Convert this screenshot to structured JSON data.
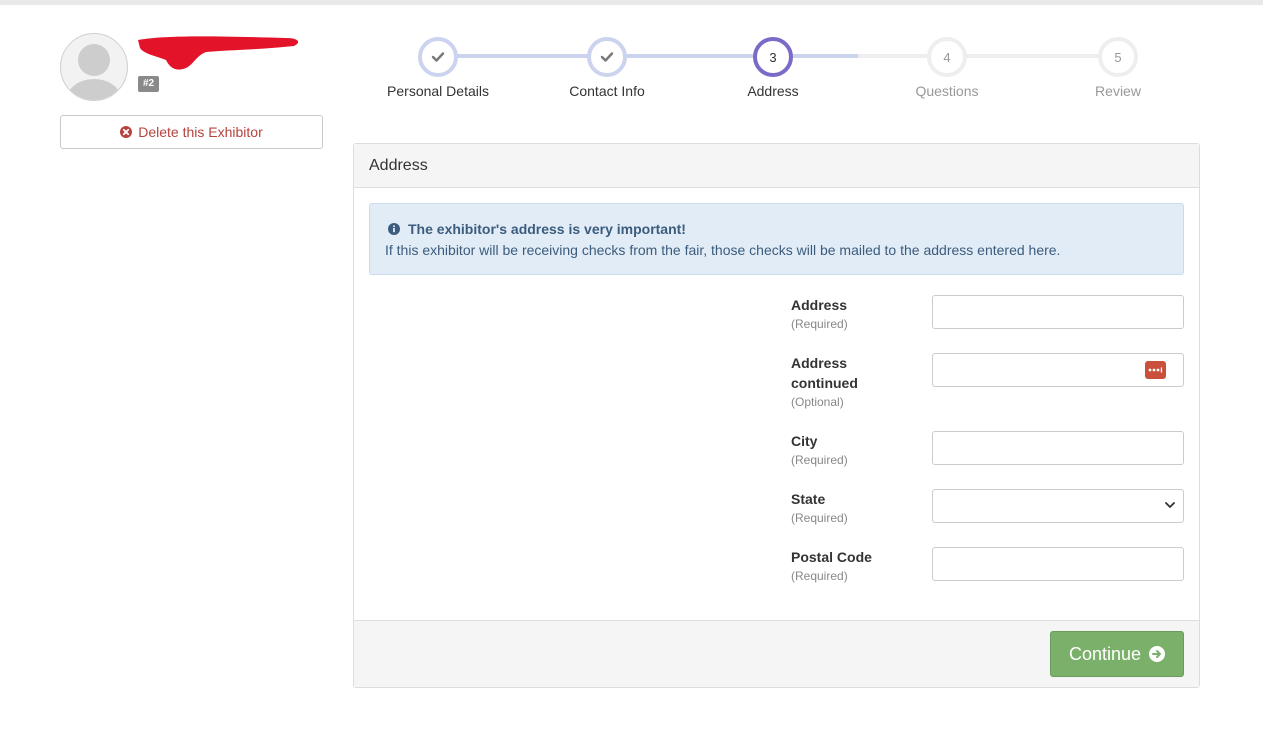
{
  "profile": {
    "id_badge": "#2",
    "delete_label": "Delete this Exhibitor"
  },
  "steps": [
    {
      "number": "1",
      "label": "Personal Details",
      "state": "done"
    },
    {
      "number": "2",
      "label": "Contact Info",
      "state": "done"
    },
    {
      "number": "3",
      "label": "Address",
      "state": "active"
    },
    {
      "number": "4",
      "label": "Questions",
      "state": "todo"
    },
    {
      "number": "5",
      "label": "Review",
      "state": "todo"
    }
  ],
  "panel": {
    "title": "Address",
    "alert": {
      "title": "The exhibitor's address is very important!",
      "body": "If this exhibitor will be receiving checks from the fair, those checks will be mailed to the address entered here."
    },
    "fields": [
      {
        "label": "Address",
        "hint": "(Required)",
        "value": ""
      },
      {
        "label_line1": "Address",
        "label_line2": "continued",
        "hint": "(Optional)",
        "value": ""
      },
      {
        "label": "City",
        "hint": "(Required)",
        "value": ""
      },
      {
        "label": "State",
        "hint": "(Required)",
        "value": ""
      },
      {
        "label": "Postal Code",
        "hint": "(Required)",
        "value": ""
      }
    ],
    "continue_label": "Continue"
  },
  "colors": {
    "accent_active": "#7b6ac8",
    "step_done": "#ccd3ee",
    "danger": "#b5443f",
    "success": "#7ab06a",
    "alert_bg": "#e2ecf6"
  }
}
